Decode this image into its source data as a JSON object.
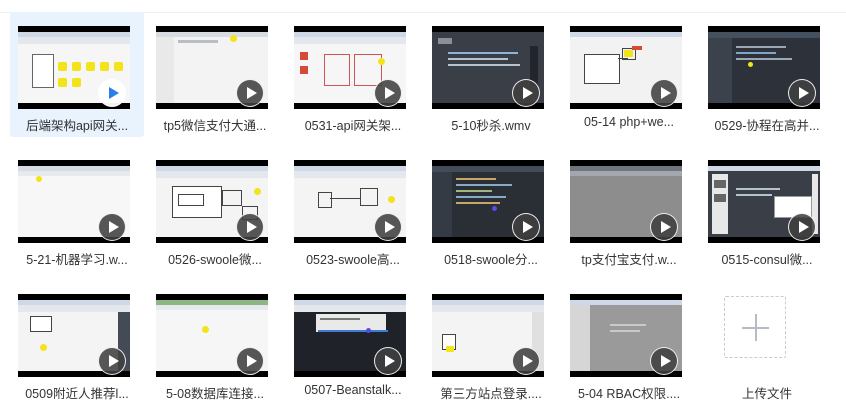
{
  "files": [
    {
      "name": "后端架构api网关...",
      "thumb_icon": "video-thumbnail-icon",
      "selected": true
    },
    {
      "name": "tp5微信支付大通...",
      "thumb_icon": "video-thumbnail-icon"
    },
    {
      "name": "0531-api网关架...",
      "thumb_icon": "video-thumbnail-icon"
    },
    {
      "name": "5-10秒杀.wmv",
      "thumb_icon": "video-thumbnail-icon"
    },
    {
      "name": "05-14 php+we...",
      "thumb_icon": "video-thumbnail-icon"
    },
    {
      "name": "0529-协程在高并...",
      "thumb_icon": "video-thumbnail-icon"
    },
    {
      "name": "5-21-机器学习.w...",
      "thumb_icon": "video-thumbnail-icon"
    },
    {
      "name": "0526-swoole微...",
      "thumb_icon": "video-thumbnail-icon"
    },
    {
      "name": "0523-swoole高...",
      "thumb_icon": "video-thumbnail-icon"
    },
    {
      "name": "0518-swoole分...",
      "thumb_icon": "video-thumbnail-icon"
    },
    {
      "name": "tp支付宝支付.w...",
      "thumb_icon": "video-thumbnail-icon"
    },
    {
      "name": "0515-consul微...",
      "thumb_icon": "video-thumbnail-icon"
    },
    {
      "name": "0509附近人推荐l...",
      "thumb_icon": "video-thumbnail-icon"
    },
    {
      "name": "5-08数据库连接...",
      "thumb_icon": "video-thumbnail-icon"
    },
    {
      "name": "0507-Beanstalk...",
      "thumb_icon": "video-thumbnail-icon"
    },
    {
      "name": "第三方站点登录....",
      "thumb_icon": "video-thumbnail-icon"
    },
    {
      "name": "5-04 RBAC权限....",
      "thumb_icon": "video-thumbnail-icon"
    }
  ],
  "upload": {
    "label": "上传文件",
    "icon": "plus-icon"
  },
  "colors": {
    "selected_bg": "#e8f3fd",
    "active_play": "#2b7de9",
    "highlight_dot": "#f2e31a"
  }
}
